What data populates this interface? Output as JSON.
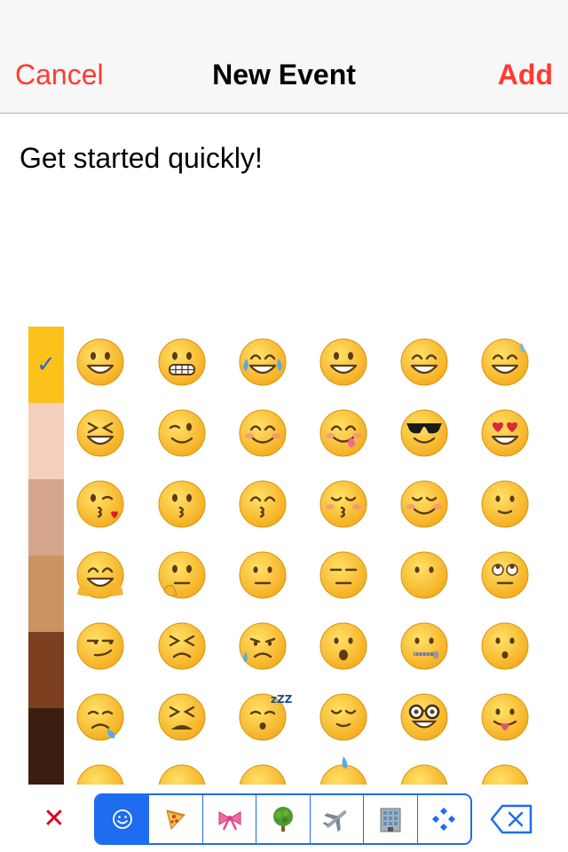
{
  "nav": {
    "cancel_label": "Cancel",
    "title": "New Event",
    "add_label": "Add"
  },
  "event": {
    "title_value": "Get started quickly!"
  },
  "skin_tones": {
    "selected_mark": "✓",
    "colors": [
      "#fcc21b",
      "#f5d0bd",
      "#d4a58b",
      "#c99461",
      "#7c3f1f",
      "#3a1e10"
    ]
  },
  "emoji_grid": {
    "rows": [
      [
        "grinning",
        "grimacing",
        "joy",
        "smiley",
        "smile",
        "sweat-smile"
      ],
      [
        "laughing",
        "wink",
        "blush",
        "yum",
        "sunglasses",
        "heart-eyes"
      ],
      [
        "kissing-heart",
        "kissing",
        "kissing-smiling-eyes",
        "kissing-closed-eyes",
        "relaxed",
        "slight-smile"
      ],
      [
        "hugging",
        "thinking",
        "neutral",
        "expressionless",
        "no-mouth",
        "rolling-eyes"
      ],
      [
        "smirk",
        "persevere",
        "disappointed-relieved",
        "open-mouth",
        "zipper-mouth",
        "hushed"
      ],
      [
        "sleepy",
        "tired",
        "sleeping",
        "relieved",
        "nerd",
        "tongue"
      ],
      [
        "cut-off",
        "cut-off",
        "cut-off",
        "cut-off-drop",
        "cut-off",
        "cut-off"
      ]
    ]
  },
  "bottom_bar": {
    "clear_glyph": "✕",
    "categories": [
      "smileys",
      "food",
      "objects",
      "nature",
      "travel",
      "places",
      "symbols"
    ],
    "active_category": "smileys",
    "accent_color": "#1e6cf0",
    "clear_color": "#e0001a"
  }
}
